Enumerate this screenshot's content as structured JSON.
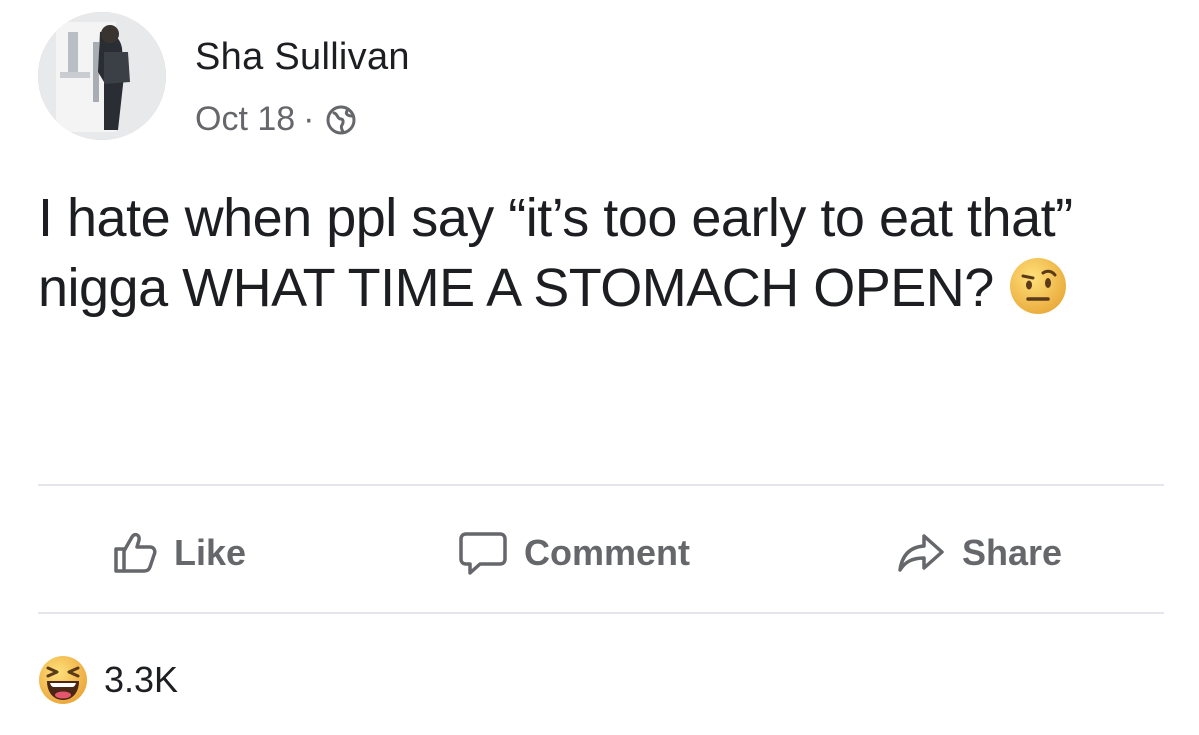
{
  "post": {
    "author": "Sha Sullivan",
    "date": "Oct 18",
    "separator": "·",
    "audience_icon": "globe-icon",
    "text": "I hate when ppl say “it’s too early to eat that” nigga WHAT TIME A STOMACH OPEN?",
    "inline_emoji": "raised-eyebrow-face-icon"
  },
  "actions": {
    "like_label": "Like",
    "comment_label": "Comment",
    "share_label": "Share"
  },
  "reactions": {
    "icon": "laughing-face-icon",
    "count": "3.3K"
  },
  "colors": {
    "text": "#1c1e21",
    "secondary": "#65676b",
    "divider": "#e4e6eb",
    "emoji": "#f5c542"
  }
}
